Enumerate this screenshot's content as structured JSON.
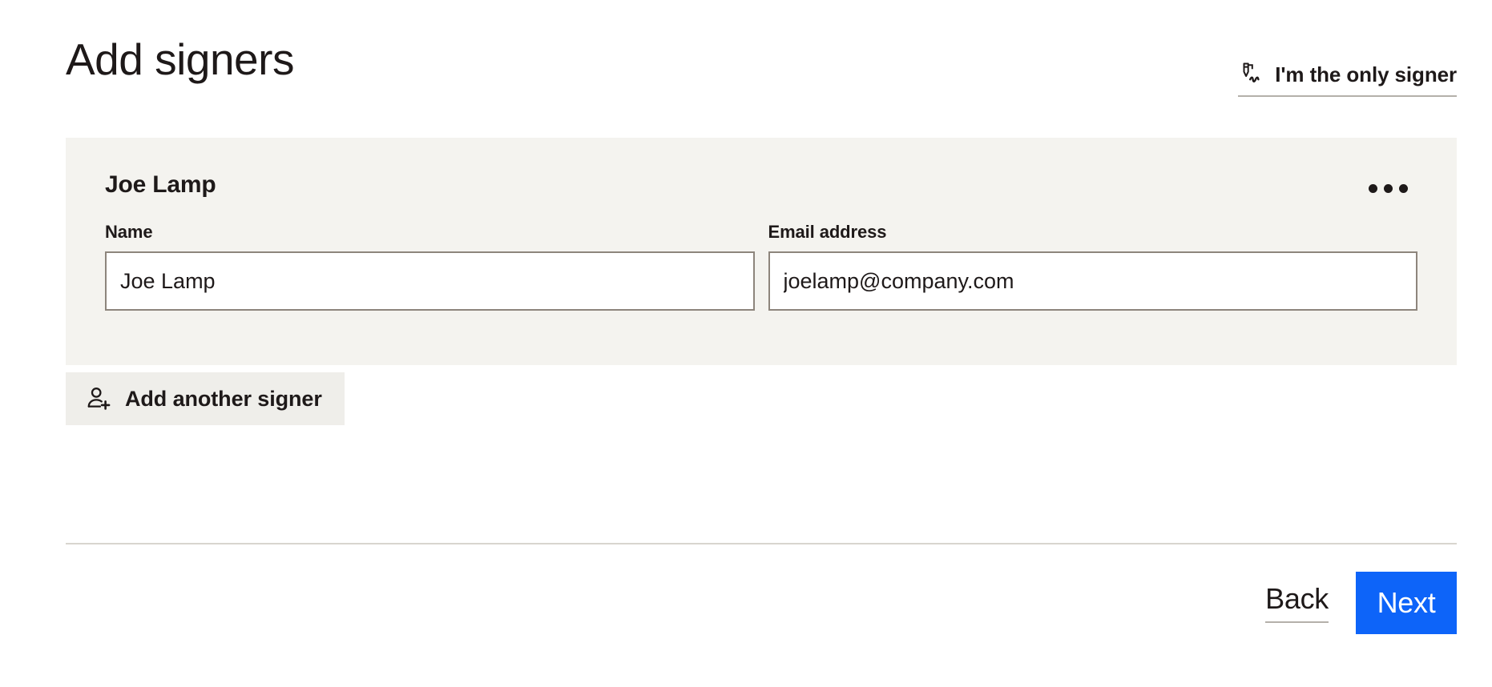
{
  "header": {
    "title": "Add signers",
    "only_signer": {
      "label": "I'm the only signer",
      "icon": "signature-pen-icon"
    }
  },
  "signer_card": {
    "name_heading": "Joe Lamp",
    "overflow_menu": {
      "icon": "ellipsis-horizontal-icon",
      "label": "..."
    },
    "fields": {
      "name": {
        "label": "Name",
        "value": "Joe Lamp",
        "placeholder": "Name"
      },
      "email": {
        "label": "Email address",
        "value": "joelamp@company.com",
        "placeholder": "Email address"
      }
    }
  },
  "add_signer": {
    "label": "Add another signer",
    "icon": "add-user-icon"
  },
  "footer": {
    "back_label": "Back",
    "next_label": "Next"
  },
  "colors": {
    "page_background": "#ffffff",
    "card_background": "#f4f3ef",
    "button_background": "#efeeea",
    "text": "#1e1919",
    "input_border": "#8d857c",
    "divider": "#d8d5cf",
    "underline": "#b4b0aa",
    "accent_blue": "#0d64f9",
    "next_button_text": "#ffffff"
  }
}
